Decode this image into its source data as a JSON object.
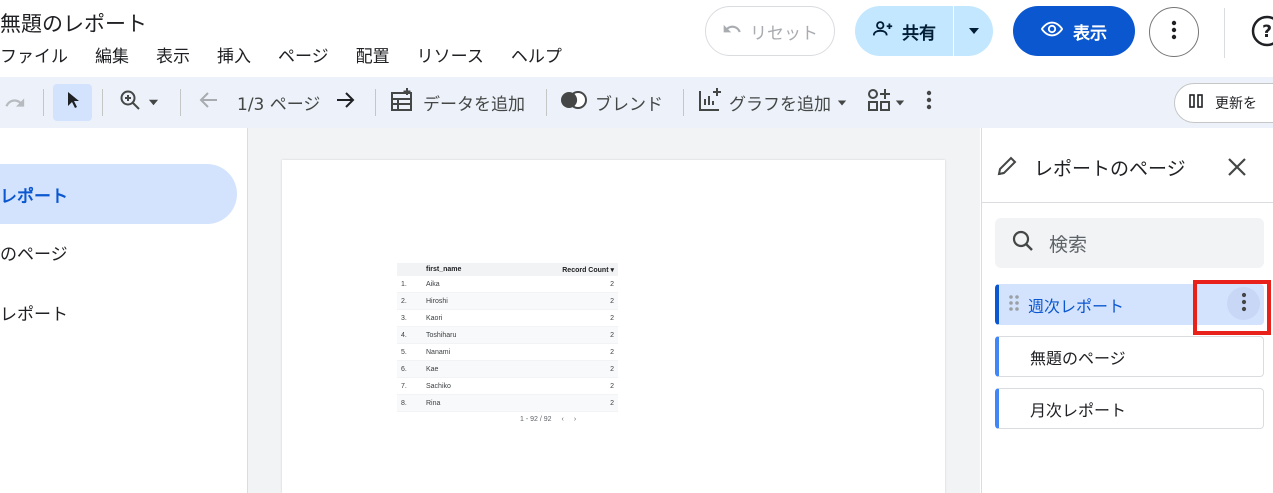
{
  "header": {
    "title": "無題のレポート",
    "menu": [
      "ファイル",
      "編集",
      "表示",
      "挿入",
      "ページ",
      "配置",
      "リソース",
      "ヘルプ"
    ],
    "reset_label": "リセット",
    "share_label": "共有",
    "view_label": "表示"
  },
  "toolbar": {
    "page_indicator": "1/3 ページ",
    "add_data_label": "データを追加",
    "blend_label": "ブレンド",
    "add_chart_label": "グラフを追加",
    "refresh_label": "更新を"
  },
  "left_nav": {
    "items": [
      "レポート",
      "のページ",
      "レポート"
    ]
  },
  "table": {
    "col_name": "first_name",
    "col_count": "Record Count",
    "rows": [
      {
        "idx": "1.",
        "name": "Aika",
        "count": "2"
      },
      {
        "idx": "2.",
        "name": "Hiroshi",
        "count": "2"
      },
      {
        "idx": "3.",
        "name": "Kaori",
        "count": "2"
      },
      {
        "idx": "4.",
        "name": "Toshiharu",
        "count": "2"
      },
      {
        "idx": "5.",
        "name": "Nanami",
        "count": "2"
      },
      {
        "idx": "6.",
        "name": "Kae",
        "count": "2"
      },
      {
        "idx": "7.",
        "name": "Sachiko",
        "count": "2"
      },
      {
        "idx": "8.",
        "name": "Rina",
        "count": "2"
      }
    ],
    "pager": "1 - 92 / 92"
  },
  "right_panel": {
    "title": "レポートのページ",
    "search_placeholder": "検索",
    "pages": [
      "週次レポート",
      "無題のページ",
      "月次レポート"
    ]
  },
  "colors": {
    "accent": "#0b57d0",
    "share_bg": "#c2e7ff",
    "selected_bg": "#d3e3fd",
    "highlight": "#e8221b"
  }
}
